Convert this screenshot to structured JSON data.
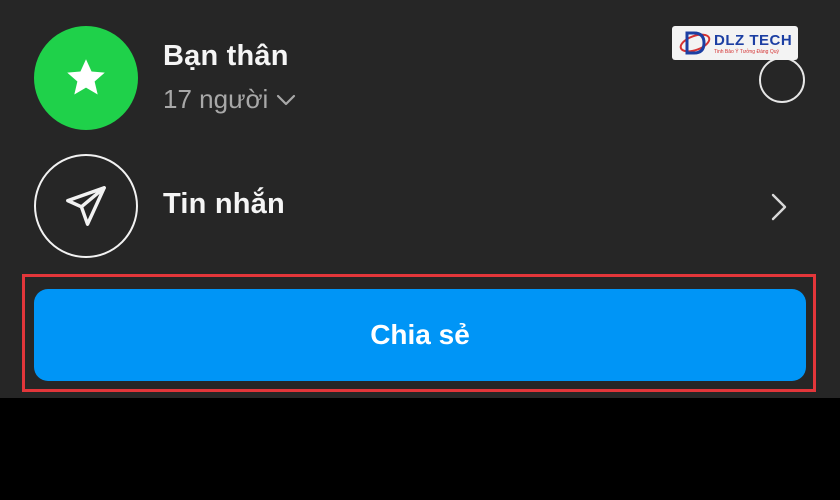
{
  "close_friends": {
    "title": "Bạn thân",
    "count_label": "17 người",
    "icon": "star-icon",
    "icon_bg": "#1fd14a"
  },
  "messages": {
    "title": "Tin nhắn",
    "icon": "paper-plane-icon"
  },
  "share": {
    "label": "Chia sẻ",
    "color": "#0095f6",
    "highlight_color": "#e3363a"
  },
  "watermark": {
    "text": "DLZ TECH",
    "tagline": "Tinh Bảo Ý Tưởng Đáng Quý"
  },
  "theme": {
    "sheet_bg": "#262626",
    "text_primary": "#f5f5f5",
    "text_secondary": "#a8a8a8"
  }
}
